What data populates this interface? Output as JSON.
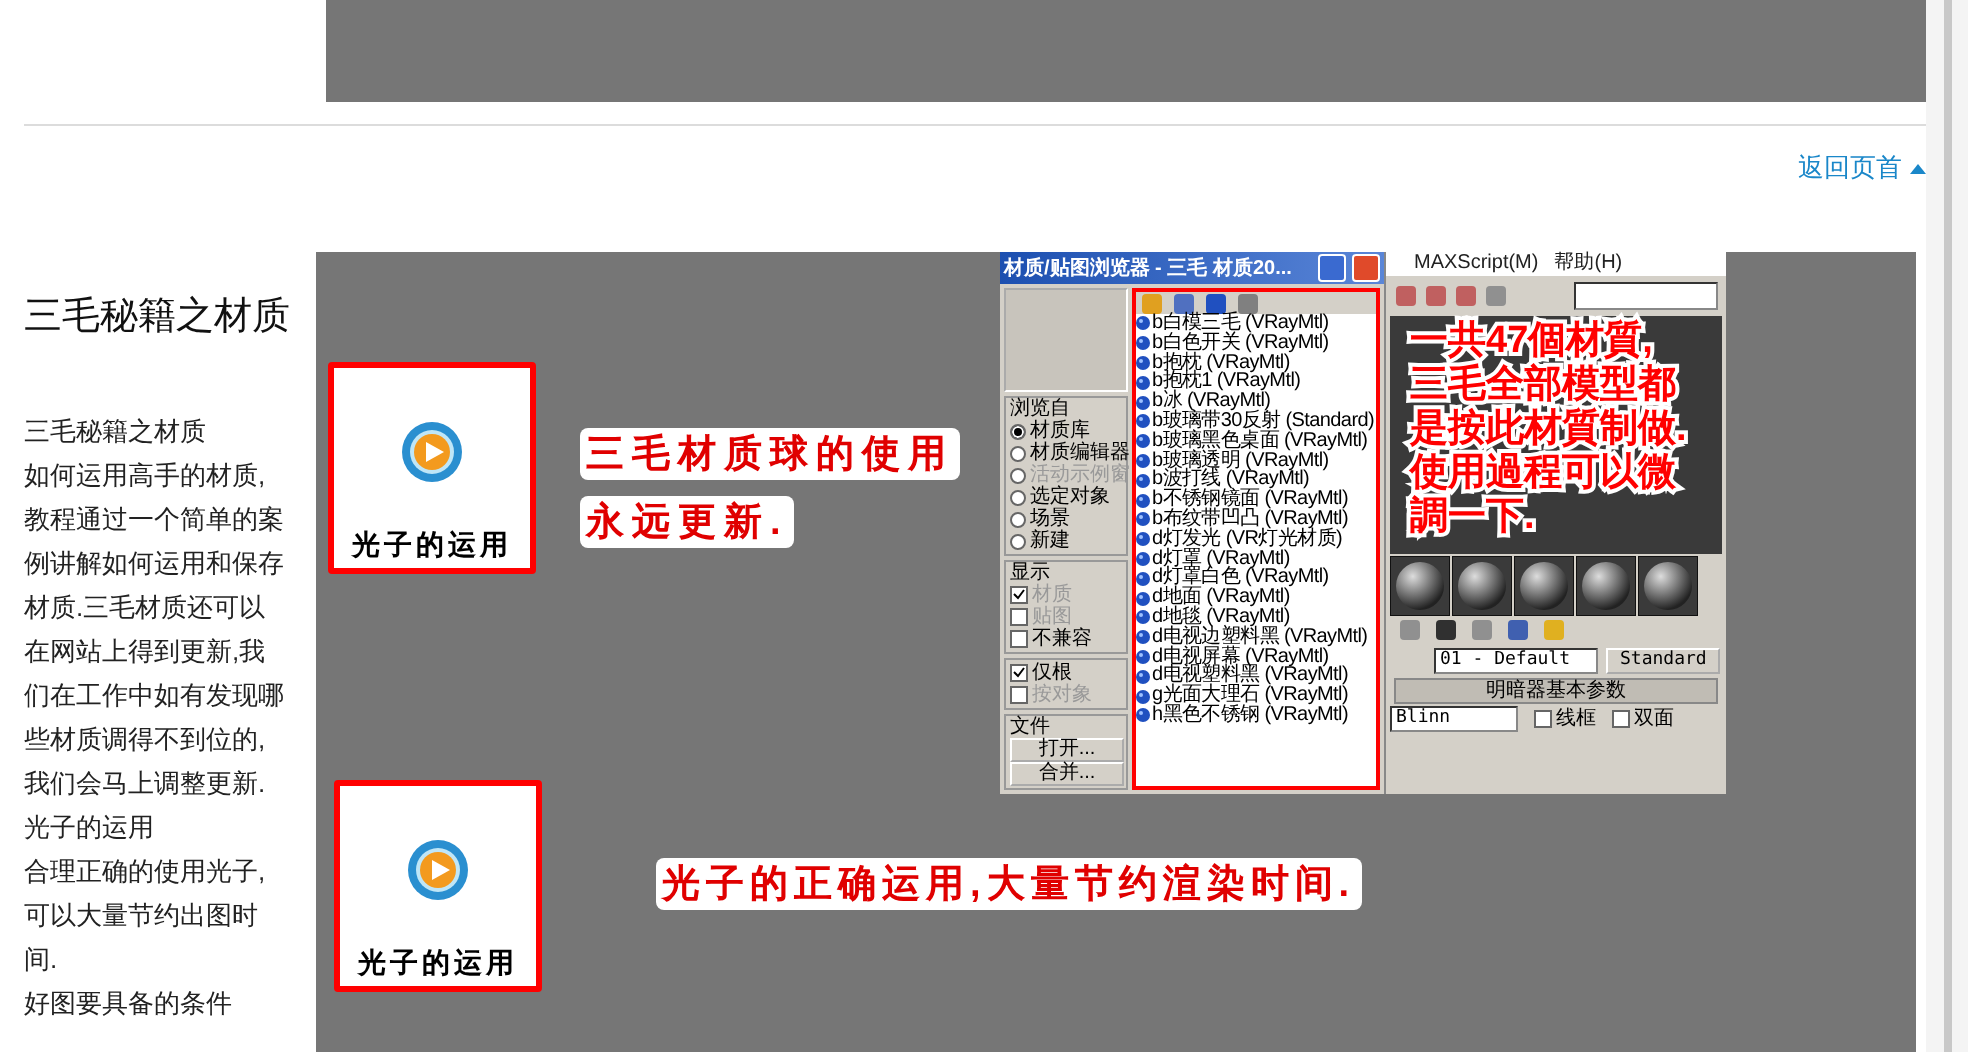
{
  "back_to_top": {
    "label": "返回页首"
  },
  "section": {
    "title": "三毛秘籍之材质",
    "paragraphs": [
      "三毛秘籍之材质",
      "如何运用高手的材质,教程通过一个简单的案例讲解如何运用和保存材质.三毛材质还可以在网站上得到更新,我们在工作中如有发现哪些材质调得不到位的,我们会马上调整更新.",
      "光子的运用",
      "合理正确的使用光子,可以大量节约出图时间.",
      "好图要具备的条件"
    ]
  },
  "banner": {
    "tiles": [
      {
        "label": "光子的运用"
      },
      {
        "label": "光子的运用"
      }
    ],
    "captions": [
      {
        "lines": [
          "三毛材质球的使用",
          "永远更新."
        ]
      },
      {
        "lines": [
          "光子的正确运用,大量节约渲染时间."
        ]
      }
    ],
    "browser": {
      "title": "材质/贴图浏览器 - 三毛 材质20...",
      "browse_from": {
        "label": "浏览自",
        "options": [
          {
            "label": "材质库",
            "selected": true,
            "disabled": false
          },
          {
            "label": "材质编辑器",
            "selected": false,
            "disabled": false
          },
          {
            "label": "活动示例窗",
            "selected": false,
            "disabled": true
          },
          {
            "label": "选定对象",
            "selected": false,
            "disabled": false
          },
          {
            "label": "场景",
            "selected": false,
            "disabled": false
          },
          {
            "label": "新建",
            "selected": false,
            "disabled": false
          }
        ]
      },
      "show": {
        "label": "显示",
        "options": [
          {
            "label": "材质",
            "checked": true,
            "disabled": true
          },
          {
            "label": "贴图",
            "checked": false,
            "disabled": true
          },
          {
            "label": "不兼容",
            "checked": false,
            "disabled": false
          }
        ]
      },
      "root_options": [
        {
          "label": "仅根",
          "checked": true,
          "disabled": false
        },
        {
          "label": "按对象",
          "checked": false,
          "disabled": true
        }
      ],
      "file": {
        "label": "文件",
        "buttons": [
          "打开...",
          "合并..."
        ]
      },
      "materials": [
        "b白模三毛 (VRayMtl)",
        "b白色开关 (VRayMtl)",
        "b抱枕 (VRayMtl)",
        "b抱枕1 (VRayMtl)",
        "b冰 (VRayMtl)",
        "b玻璃带30反射 (Standard)",
        "b玻璃黑色桌面 (VRayMtl)",
        "b玻璃透明 (VRayMtl)",
        "b波打线 (VRayMtl)",
        "b不锈钢镜面 (VRayMtl)",
        "b布纹带凹凸 (VRayMtl)",
        "d灯发光 (VR灯光材质)",
        "d灯罩 (VRayMtl)",
        "d灯罩白色 (VRayMtl)",
        "d地面 (VRayMtl)",
        "d地毯 (VRayMtl)",
        "d电视边塑料黑 (VRayMtl)",
        "d电视屏幕 (VRayMtl)",
        "d电视塑料黑 (VRayMtl)",
        "g光面大理石 (VRayMtl)",
        "h黑色不锈钢 (VRayMtl)"
      ]
    },
    "editor": {
      "menu": [
        "MAXScript(M)",
        "帮助(H)"
      ],
      "material_name": "01 - Default",
      "material_type": "Standard",
      "rollout": "明暗器基本参数",
      "shader": "Blinn",
      "options": [
        {
          "label": "线框",
          "checked": false
        },
        {
          "label": "双面",
          "checked": false
        }
      ],
      "note_lines": [
        "一共47個材質,",
        "三毛全部模型都",
        "是按此材質制做.",
        "使用過程可以微",
        "調一下."
      ]
    }
  }
}
